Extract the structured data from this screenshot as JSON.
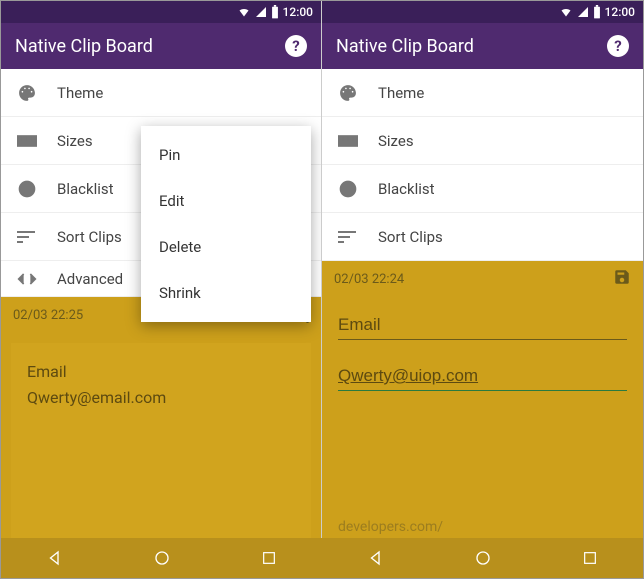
{
  "statusbar": {
    "time": "12:00"
  },
  "appbar": {
    "title": "Native Clip Board"
  },
  "settings": {
    "theme": "Theme",
    "sizes": "Sizes",
    "blacklist": "Blacklist",
    "sort": "Sort Clips",
    "advanced": "Advanced"
  },
  "left": {
    "timestamp": "02/03 22:25",
    "clip_title": "Email",
    "clip_body": "Qwerty@email.com"
  },
  "right": {
    "timestamp": "02/03 22:24",
    "field_title": "Email",
    "field_body": "Qwerty@uiop.com",
    "faded": "developers.com/"
  },
  "menu": {
    "pin": "Pin",
    "edit": "Edit",
    "delete": "Delete",
    "shrink": "Shrink"
  }
}
